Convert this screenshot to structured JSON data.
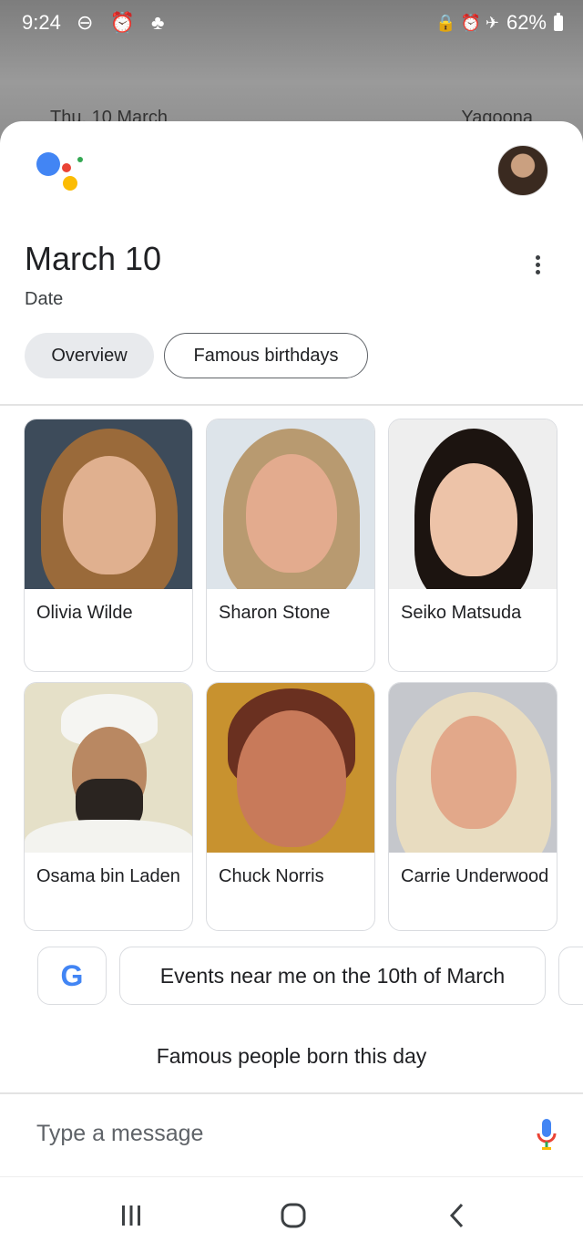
{
  "status_bar": {
    "time": "9:24",
    "left_icons": "⊖ ⏰ ♣",
    "right_icons": "🔒 ⏰ ✈",
    "battery": "62%"
  },
  "lockscreen": {
    "date": "Thu, 10 March",
    "location": "Yagoona"
  },
  "assistant": {
    "logo_colors": [
      "#4285f4",
      "#ea4335",
      "#fbbc04",
      "#34a853"
    ],
    "title": "March 10",
    "subtitle": "Date",
    "chips": [
      {
        "label": "Overview"
      },
      {
        "label": "Famous birthdays"
      }
    ],
    "people": [
      {
        "name": "Olivia Wilde"
      },
      {
        "name": "Sharon Stone"
      },
      {
        "name": "Seiko Matsuda"
      },
      {
        "name": "Osama bin Laden"
      },
      {
        "name": "Chuck Norris"
      },
      {
        "name": "Carrie Underwood"
      }
    ]
  },
  "suggestions": {
    "google_letter": "G",
    "events": "Events near me on the 10th of March"
  },
  "famous_people": "Famous people born this day",
  "composer": {
    "placeholder": "Type a message"
  },
  "navbar": {
    "recents": "|||",
    "home": "○",
    "back": "‹"
  }
}
